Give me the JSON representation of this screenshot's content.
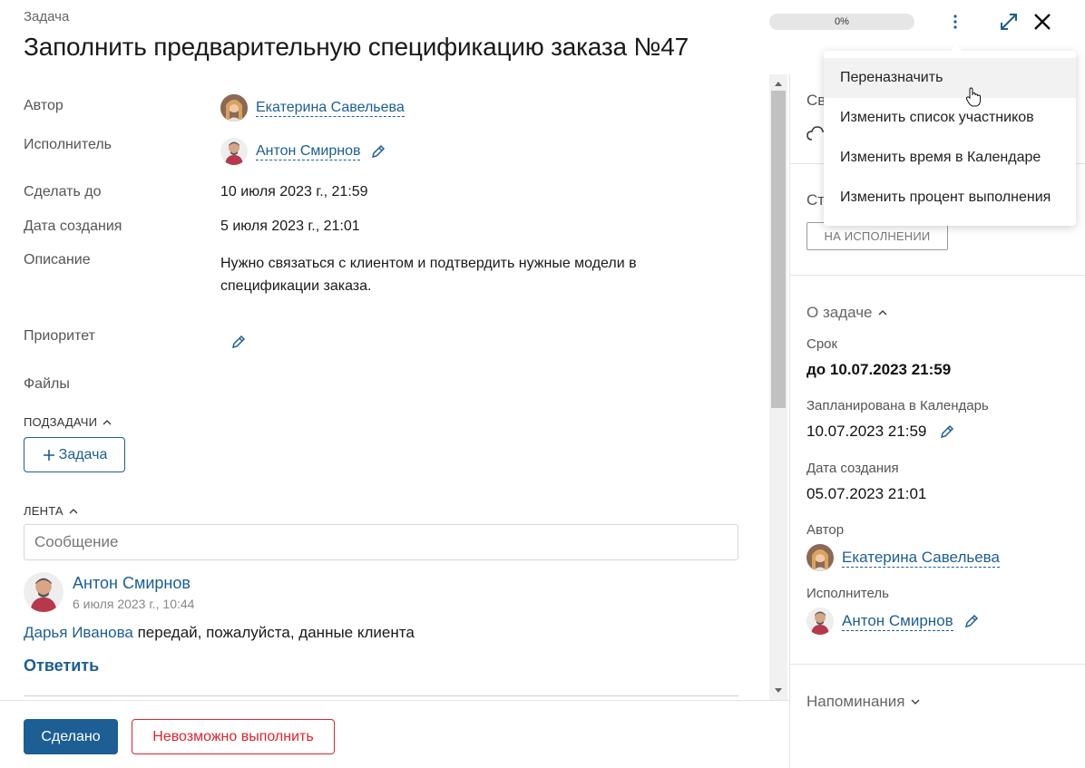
{
  "header": {
    "kind": "Задача",
    "title": "Заполнить предварительную спецификацию заказа №47",
    "progress": "0%",
    "progress_value": 0
  },
  "fields": {
    "author_label": "Автор",
    "author_name": "Екатерина Савельева",
    "assignee_label": "Исполнитель",
    "assignee_name": "Антон Смирнов",
    "deadline_label": "Сделать до",
    "deadline_value": "10 июля 2023 г., 21:59",
    "created_label": "Дата создания",
    "created_value": "5 июля 2023 г., 21:01",
    "description_label": "Описание",
    "description_value": "Нужно связаться с клиентом и подтвердить нужные модели в спецификации заказа.",
    "priority_label": "Приоритет",
    "files_label": "Файлы"
  },
  "subtasks": {
    "heading": "ПОДЗАДАЧИ",
    "add_button": "Задача"
  },
  "feed": {
    "heading": "ЛЕНТА",
    "message_placeholder": "Сообщение",
    "comment": {
      "author": "Антон Смирнов",
      "date": "6 июля 2023 г., 10:44",
      "mention": "Дарья Иванова",
      "text": " передай, пожалуйста, данные клиента",
      "reply": "Ответить"
    }
  },
  "footer": {
    "done_button": "Сделано",
    "cannot_button": "Невозможно выполнить"
  },
  "right_panel": {
    "section1_partial": "Св",
    "status_partial": "Ст",
    "status_badge": "НА ИСПОЛНЕНИИ",
    "about_heading": "О задаче",
    "term_label": "Срок",
    "term_value": "до 10.07.2023 21:59",
    "calendar_label": "Запланирована в Календарь",
    "calendar_value": "10.07.2023 21:59",
    "created_label": "Дата создания",
    "created_value": "05.07.2023 21:01",
    "author_label": "Автор",
    "author_name": "Екатерина Савельева",
    "assignee_label": "Исполнитель",
    "assignee_name": "Антон Смирнов",
    "reminders_heading": "Напоминания"
  },
  "dropdown_menu": {
    "items": [
      "Переназначить",
      "Изменить список участников",
      "Изменить время в Календаре",
      "Изменить процент выполнения"
    ]
  },
  "colors": {
    "accent": "#1d5e94",
    "danger": "#e0242f",
    "link": "#1d5e94"
  }
}
